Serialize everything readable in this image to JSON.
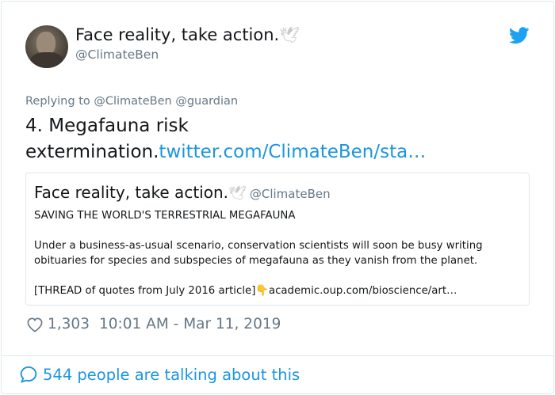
{
  "author": {
    "name": "Face reality, take action.",
    "emoji": "🕊",
    "handle": "@ClimateBen"
  },
  "reply": {
    "prefix": "Replying to",
    "mentions": "@ClimateBen @guardian"
  },
  "tweet": {
    "text": "4. Megafauna risk extermination.",
    "link": "twitter.com/ClimateBen/sta…"
  },
  "quoted_tweet": {
    "name": "Face reality, take action.",
    "emoji": "🕊",
    "handle": "@ClimateBen",
    "heading": "SAVING THE WORLD'S TERRESTRIAL MEGAFAUNA",
    "paragraph": "Under a business-as-usual scenario, conservation scientists will soon be busy writing obituaries for species and subspecies of megafauna as they vanish from the planet.",
    "thread_note": "[THREAD of quotes from July 2016 article]",
    "pointing_emoji": "👇",
    "link": "academic.oup.com/bioscience/art…"
  },
  "meta": {
    "likes": "1,303",
    "time": "10:01 AM - Mar 11, 2019"
  },
  "footer": {
    "talking": "544 people are talking about this"
  },
  "colors": {
    "link": "#1b95e0",
    "secondary_text": "#657786",
    "border": "#e1e8ed"
  },
  "icons": [
    "twitter-bird-icon",
    "heart-icon",
    "speech-bubble-icon",
    "dove-emoji"
  ]
}
